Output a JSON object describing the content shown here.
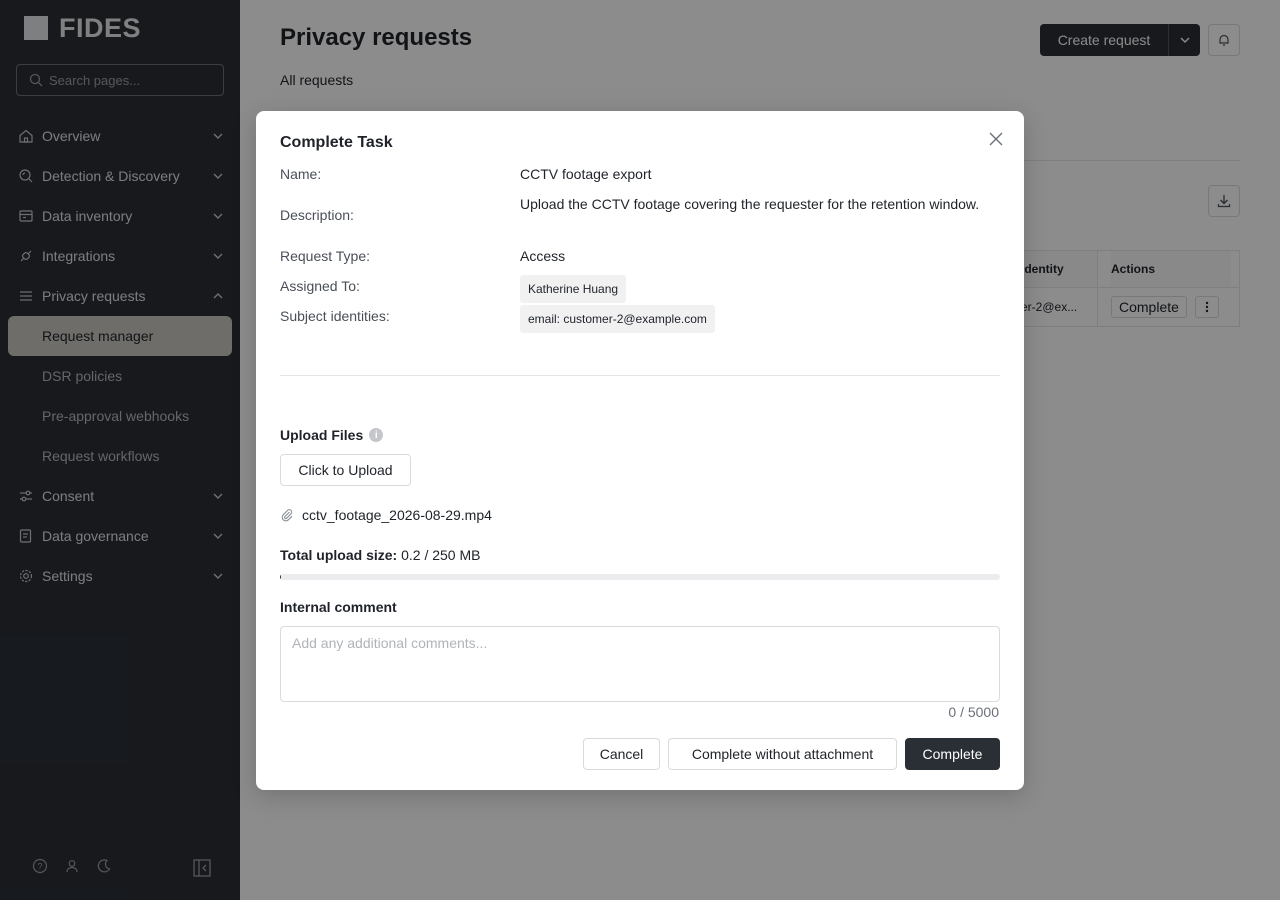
{
  "app": {
    "logo_text": "FIDES"
  },
  "sidebar": {
    "search_placeholder": "Search pages...",
    "items": [
      {
        "label": "Overview",
        "icon": "home-icon",
        "expanded": false
      },
      {
        "label": "Detection & Discovery",
        "icon": "radar-search-icon",
        "expanded": false
      },
      {
        "label": "Data inventory",
        "icon": "inventory-icon",
        "expanded": false
      },
      {
        "label": "Integrations",
        "icon": "plug-icon",
        "expanded": false
      },
      {
        "label": "Privacy requests",
        "icon": "list-icon",
        "expanded": true
      },
      {
        "label": "Consent",
        "icon": "sliders-icon",
        "expanded": false
      },
      {
        "label": "Data governance",
        "icon": "shield-doc-icon",
        "expanded": false
      },
      {
        "label": "Settings",
        "icon": "gear-icon",
        "expanded": false
      }
    ],
    "sub_items": [
      {
        "label": "Request manager",
        "active": true
      },
      {
        "label": "DSR policies",
        "active": false
      },
      {
        "label": "Pre-approval webhooks",
        "active": false
      },
      {
        "label": "Request workflows",
        "active": false
      }
    ]
  },
  "header": {
    "title": "Privacy requests",
    "subtitle": "All requests",
    "create_label": "Create request"
  },
  "table": {
    "col_identity": "Identity",
    "col_actions": "Actions",
    "row_identity": "er-2@ex...",
    "row_action": "Complete"
  },
  "modal": {
    "title": "Complete Task",
    "fields": {
      "name_label": "Name:",
      "name_value": "CCTV footage export",
      "description_label": "Description:",
      "description_value": "Upload the CCTV footage covering the requester for the retention window.",
      "request_type_label": "Request Type:",
      "request_type_value": "Access",
      "assigned_label": "Assigned To:",
      "assigned_value": "Katherine Huang",
      "identities_label": "Subject identities:",
      "identities_value": "email: customer-2@example.com"
    },
    "upload": {
      "label": "Upload Files",
      "button": "Click to Upload",
      "file_name": "cctv_footage_2026-08-29.mp4",
      "size_label": "Total upload size:",
      "size_value": "0.2 / 250 MB",
      "progress_fraction": 0.0008
    },
    "comment": {
      "label": "Internal comment",
      "placeholder": "Add any additional comments...",
      "value": "",
      "counter": "0 / 5000"
    },
    "buttons": {
      "cancel": "Cancel",
      "complete_without": "Complete without attachment",
      "complete": "Complete"
    }
  }
}
